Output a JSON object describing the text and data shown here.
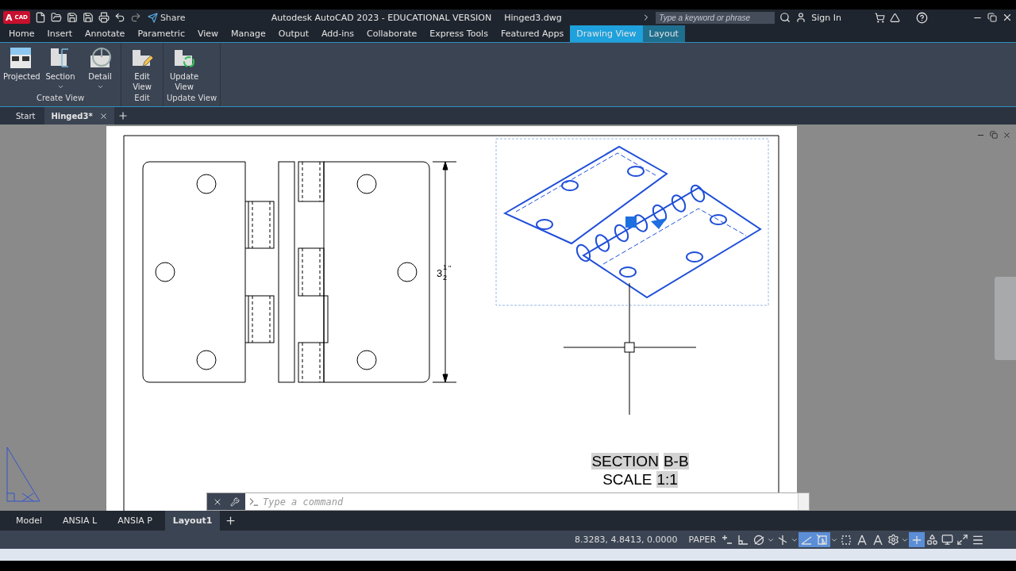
{
  "title_bar": {
    "logo": {
      "letter": "A",
      "text": "CAD"
    },
    "share": "Share",
    "title": "Autodesk AutoCAD 2023 - EDUCATIONAL VERSION",
    "file_name": "Hinged3.dwg",
    "search": {
      "placeholder": "Type a keyword or phrase"
    },
    "sign_in": "Sign In"
  },
  "ribbon_tabs": [
    {
      "label": "Home",
      "selected": false,
      "contextual": false
    },
    {
      "label": "Insert",
      "selected": false,
      "contextual": false
    },
    {
      "label": "Annotate",
      "selected": false,
      "contextual": false
    },
    {
      "label": "Parametric",
      "selected": false,
      "contextual": false
    },
    {
      "label": "View",
      "selected": false,
      "contextual": false
    },
    {
      "label": "Manage",
      "selected": false,
      "contextual": false
    },
    {
      "label": "Output",
      "selected": false,
      "contextual": false
    },
    {
      "label": "Add-ins",
      "selected": false,
      "contextual": false
    },
    {
      "label": "Collaborate",
      "selected": false,
      "contextual": false
    },
    {
      "label": "Express Tools",
      "selected": false,
      "contextual": false
    },
    {
      "label": "Featured Apps",
      "selected": false,
      "contextual": false
    },
    {
      "label": "Drawing View",
      "selected": true,
      "contextual": true
    },
    {
      "label": "Layout",
      "selected": false,
      "contextual": true
    }
  ],
  "ribbon_panels": [
    {
      "title": "Create View",
      "tools": [
        {
          "kind": "projected",
          "label": "Projected",
          "dropdown": false
        },
        {
          "kind": "section",
          "label": "Section",
          "dropdown": true
        },
        {
          "kind": "detail",
          "label": "Detail",
          "dropdown": true
        }
      ]
    },
    {
      "title": "Edit",
      "tools": [
        {
          "kind": "edit",
          "label": "Edit View",
          "dropdown": false
        }
      ]
    },
    {
      "title": "Update View",
      "tools": [
        {
          "kind": "update",
          "label": "Update View",
          "dropdown": false
        }
      ]
    }
  ],
  "file_tabs": [
    {
      "label": "Start",
      "selected": false,
      "closable": false
    },
    {
      "label": "Hinged3*",
      "selected": true,
      "closable": true
    }
  ],
  "drawing": {
    "dimension": {
      "whole": "3",
      "numerator": "1",
      "denominator": "2",
      "unit": "\""
    },
    "caption": [
      [
        {
          "text": "SECTION",
          "highlighted": true
        },
        {
          "text": "B-B",
          "highlighted": true
        }
      ],
      [
        {
          "text": "SCALE",
          "highlighted": false
        },
        {
          "text": "1:1",
          "highlighted": true
        }
      ]
    ]
  },
  "command_line": {
    "placeholder": "Type a command"
  },
  "layout_tabs": [
    {
      "label": "Model",
      "selected": false
    },
    {
      "label": "ANSIA L",
      "selected": false
    },
    {
      "label": "ANSIA P",
      "selected": false
    },
    {
      "label": "Layout1",
      "selected": true
    }
  ],
  "status_bar": {
    "coordinates": "8.3283, 4.8413, 0.0000",
    "space": "PAPER",
    "tools": [
      {
        "kind": "infer",
        "on": false,
        "dropdown": false
      },
      {
        "kind": "ortho",
        "on": false,
        "dropdown": false
      },
      {
        "kind": "polar",
        "on": false,
        "dropdown": true
      },
      {
        "kind": "osnap",
        "on": false,
        "dropdown": true
      },
      {
        "kind": "isodraft",
        "on": true,
        "dropdown": false
      },
      {
        "kind": "selection",
        "on": true,
        "dropdown": true
      },
      {
        "kind": "cycle",
        "on": false,
        "dropdown": false
      },
      {
        "kind": "anno",
        "on": false,
        "dropdown": false
      },
      {
        "kind": "anno",
        "on": false,
        "dropdown": false
      },
      {
        "kind": "gear",
        "on": false,
        "dropdown": true
      },
      {
        "kind": "plus",
        "on": true,
        "dropdown": false
      },
      {
        "kind": "shapes",
        "on": false,
        "dropdown": false
      },
      {
        "kind": "monitor",
        "on": false,
        "dropdown": false
      },
      {
        "kind": "fullscreen",
        "on": false,
        "dropdown": false
      },
      {
        "kind": "menu",
        "on": false,
        "dropdown": false
      }
    ]
  }
}
